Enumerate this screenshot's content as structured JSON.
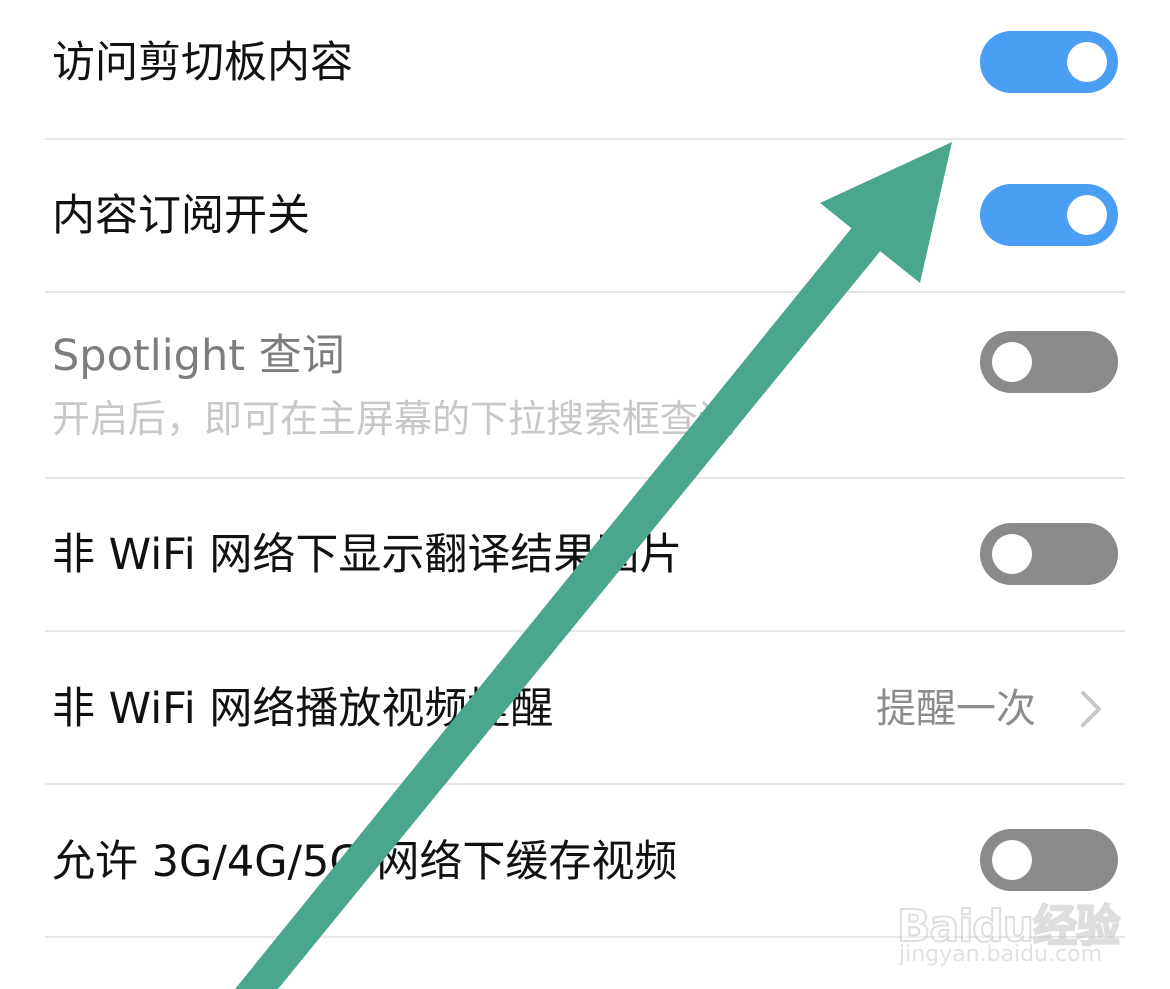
{
  "settings": {
    "clipboard": {
      "label": "访问剪切板内容",
      "toggle": "on"
    },
    "subscribe": {
      "label": "内容订阅开关",
      "toggle": "on"
    },
    "spotlight": {
      "label": "Spotlight 查词",
      "sublabel": "开启后，即可在主屏幕的下拉搜索框查词",
      "toggle": "off"
    },
    "wifi_images": {
      "label": "非 WiFi 网络下显示翻译结果图片",
      "toggle": "off"
    },
    "wifi_video": {
      "label": "非 WiFi 网络播放视频提醒",
      "value": "提醒一次"
    },
    "cache_video": {
      "label": "允许 3G/4G/5G 网络下缓存视频",
      "toggle": "off"
    }
  },
  "colors": {
    "toggle_on": "#4a9ff5",
    "toggle_off": "#8a8a8a",
    "annotation_arrow": "#4aa68c"
  },
  "annotation": {
    "icon": "arrow-up-right-icon"
  },
  "watermark": {
    "logo": "Baidu经验",
    "url": "jingyan.baidu.com"
  }
}
